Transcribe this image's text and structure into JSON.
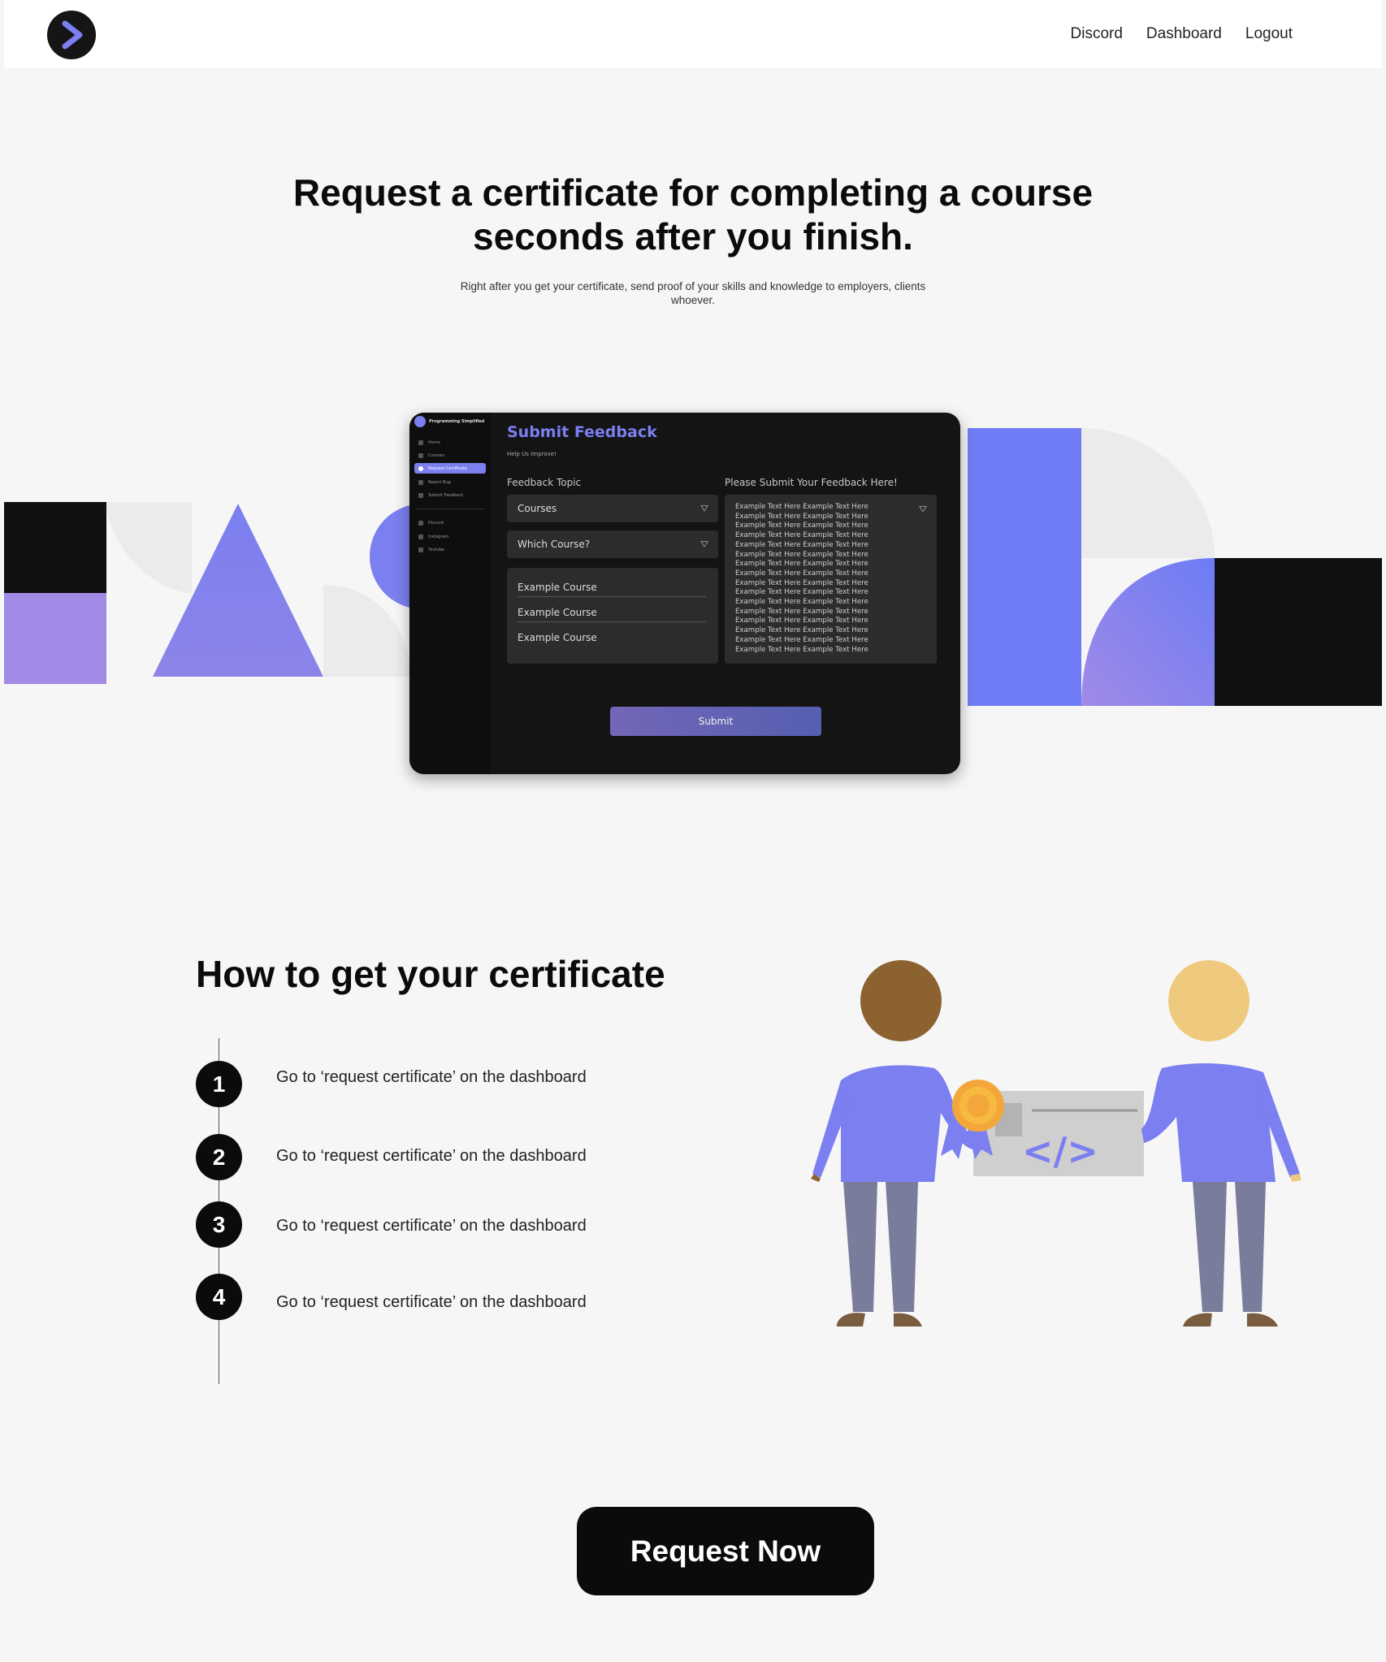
{
  "nav": {
    "links": [
      "Discord",
      "Dashboard",
      "Logout"
    ]
  },
  "hero": {
    "title": "Request a certificate for completing a course seconds after you finish.",
    "subtitle": "Right after you get your certificate, send proof of your skills and knowledge to employers, clients whoever."
  },
  "mockup": {
    "brand": "Programming Simplified",
    "sidebar": [
      "Home",
      "Courses",
      "Request Certificate",
      "Report Bug",
      "Submit Feedback",
      "Discord",
      "Instagram",
      "Youtube"
    ],
    "title": "Submit Feedback",
    "subtitle": "Help Us Improve!",
    "topic_label": "Feedback Topic",
    "feedback_label": "Please Submit Your Feedback Here!",
    "topic_value": "Courses",
    "course_value": "Which Course?",
    "course_options": [
      "Example Course",
      "Example Course",
      "Example Course"
    ],
    "feedback_text": "Example Text Here Example Text Here",
    "submit_label": "Submit"
  },
  "how": {
    "title": "How to get your certificate",
    "steps": [
      {
        "num": "1",
        "text": "Go to ‘request certificate’ on the dashboard"
      },
      {
        "num": "2",
        "text": "Go to ‘request certificate’ on the dashboard"
      },
      {
        "num": "3",
        "text": "Go to ‘request certificate’ on the dashboard"
      },
      {
        "num": "4",
        "text": "Go to ‘request certificate’ on the dashboard"
      }
    ]
  },
  "illustration": {
    "code_symbol": "</>"
  },
  "cta": {
    "label": "Request Now"
  },
  "colors": {
    "accent": "#7b7ff0",
    "dark": "#0b0b0b",
    "light_shape": "#ebebeb",
    "lavender": "#a08ae6",
    "gold": "#f3a73a"
  }
}
